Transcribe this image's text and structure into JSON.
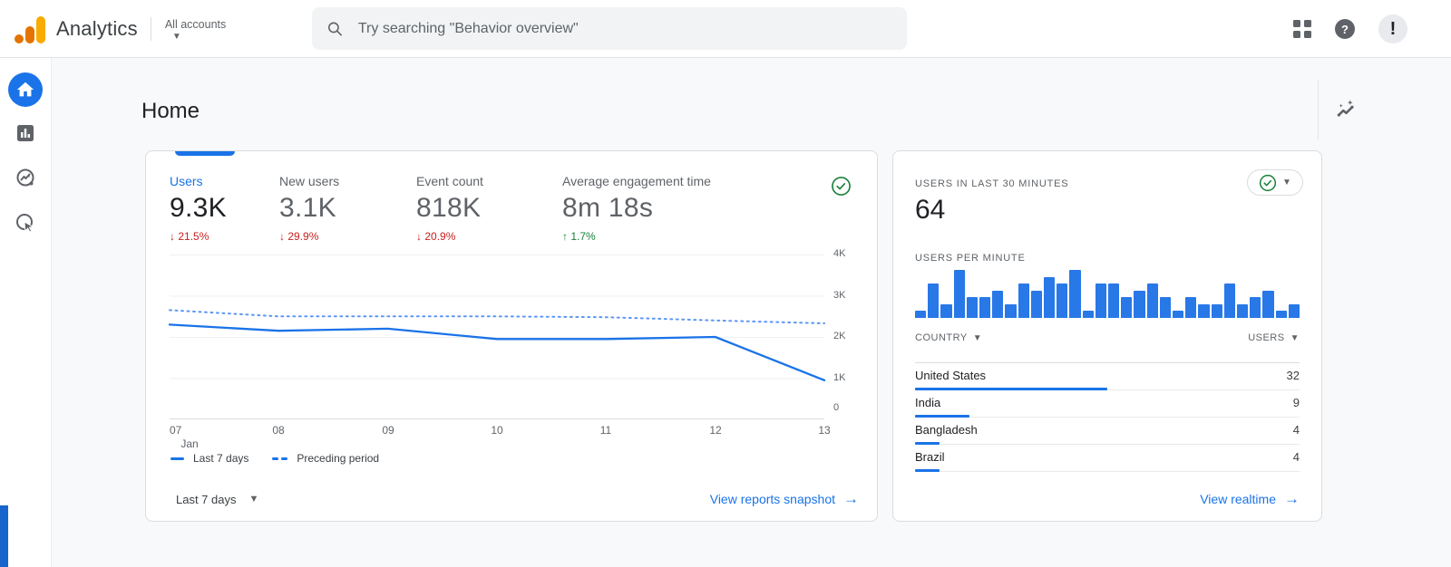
{
  "colors": {
    "accent": "#1a73e8",
    "bar": "#2878e8",
    "negative": "#c5221f",
    "positive": "#188038",
    "brand_amber": "#f9ab00",
    "brand_orange": "#e37400"
  },
  "topbar": {
    "brand": "Analytics",
    "account_label": "All accounts",
    "search_placeholder": "Try searching \"Behavior overview\""
  },
  "sidebar": {
    "items": [
      {
        "name": "home"
      },
      {
        "name": "reports"
      },
      {
        "name": "explore"
      },
      {
        "name": "advertising"
      }
    ]
  },
  "page": {
    "title": "Home"
  },
  "overview": {
    "metrics": [
      {
        "label": "Users",
        "value": "9.3K",
        "delta": "21.5%",
        "direction": "down"
      },
      {
        "label": "New users",
        "value": "3.1K",
        "delta": "29.9%",
        "direction": "down"
      },
      {
        "label": "Event count",
        "value": "818K",
        "delta": "20.9%",
        "direction": "down"
      },
      {
        "label": "Average engagement time",
        "value": "8m 18s",
        "delta": "1.7%",
        "direction": "up"
      }
    ],
    "legend": [
      {
        "label": "Last 7 days",
        "style": "solid"
      },
      {
        "label": "Preceding period",
        "style": "dashed"
      }
    ],
    "date_range_label": "Last 7 days",
    "snapshot_link": "View reports snapshot",
    "arrow": "→"
  },
  "chart_data": [
    {
      "type": "line",
      "title": "Users over time",
      "x_labels": [
        "07",
        "08",
        "09",
        "10",
        "11",
        "12",
        "13"
      ],
      "month_label": "Jan",
      "series": [
        {
          "name": "Last 7 days",
          "style": "solid",
          "values": [
            2300,
            2150,
            2200,
            1950,
            1950,
            2000,
            950
          ]
        },
        {
          "name": "Preceding period",
          "style": "dashed",
          "values": [
            2650,
            2500,
            2500,
            2500,
            2480,
            2400,
            2330
          ]
        }
      ],
      "ylim": [
        0,
        4000
      ],
      "yticks": [
        "4K",
        "3K",
        "2K",
        "1K",
        "0"
      ],
      "grid": true,
      "legend_position": "bottom"
    },
    {
      "type": "bar",
      "title": "Users per minute",
      "values": [
        1,
        5,
        2,
        7,
        3,
        3,
        4,
        2,
        5,
        4,
        6,
        5,
        7,
        1,
        5,
        5,
        3,
        4,
        5,
        3,
        1,
        3,
        2,
        2,
        5,
        2,
        3,
        4,
        1,
        2
      ],
      "ylim": [
        0,
        7
      ]
    }
  ],
  "realtime": {
    "title": "USERS IN LAST 30 MINUTES",
    "value": "64",
    "per_minute_label": "USERS PER MINUTE",
    "table_headers": {
      "country": "COUNTRY",
      "users": "USERS"
    },
    "countries": [
      {
        "name": "United States",
        "users": "32"
      },
      {
        "name": "India",
        "users": "9"
      },
      {
        "name": "Bangladesh",
        "users": "4"
      },
      {
        "name": "Brazil",
        "users": "4"
      }
    ],
    "realtime_link": "View realtime",
    "arrow": "→"
  }
}
